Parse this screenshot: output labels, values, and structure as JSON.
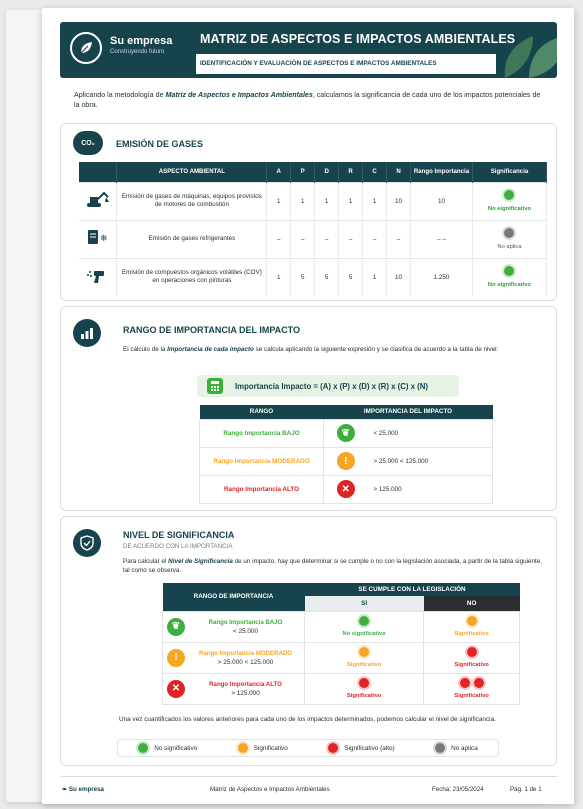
{
  "header": {
    "brand": "Su empresa",
    "tagline": "Construyendo futuro",
    "title": "MATRIZ DE ASPECTOS E IMPACTOS AMBIENTALES",
    "subtitle": "IDENTIFICACIÓN Y EVALUACIÓN DE ASPECTOS E IMPACTOS AMBIENTALES"
  },
  "intro": {
    "pre": "Aplicando la metodología de ",
    "bold": "Matriz de Aspectos e Impactos Ambientales",
    "post": ", calculamos la significancia de cada uno de los impactos potenciales de la obra."
  },
  "emision": {
    "icon_text": "CO₂",
    "title": "EMISIÓN DE GASES",
    "columns": [
      "ASPECTO AMBIENTAL",
      "A",
      "P",
      "D",
      "R",
      "C",
      "N",
      "Rango Importancia",
      "Significancia"
    ],
    "rows": [
      {
        "icon": "excavator-icon",
        "aspect": "Emisión de gases de máquinas, equipos provistos de motores de combustión",
        "A": "1",
        "P": "1",
        "D": "1",
        "R": "1",
        "C": "1",
        "N": "10",
        "rango": "10",
        "sig": "No significativo",
        "sig_color": "#3fae3f"
      },
      {
        "icon": "refrigerator-icon",
        "aspect": "Emisión de gases refrigerantes",
        "A": "–",
        "P": "–",
        "D": "–",
        "R": "–",
        "C": "–",
        "N": "–",
        "rango": "– –",
        "sig": "No aplica",
        "sig_color": "#7a7a7a"
      },
      {
        "icon": "spray-gun-icon",
        "aspect": "Emisión de compuestos orgánicos volátiles (COV) en operaciones con pinturas",
        "A": "1",
        "P": "5",
        "D": "5",
        "R": "5",
        "C": "1",
        "N": "10",
        "rango": "1.250",
        "sig": "No significativo",
        "sig_color": "#3fae3f"
      }
    ]
  },
  "rango": {
    "title": "RANGO DE IMPORTANCIA DEL IMPACTO",
    "p_pre": "El cálculo de la ",
    "p_bold": "Importancia de cada impacto",
    "p_post": " se calcula aplicando la siguiente expresión y se clasifica de acuerdo a la tabla de nivel:",
    "formula": "Importancia Impacto = (A) x (P) x (D) x (R) x (C) x (N)",
    "col_rango": "RANGO",
    "col_imp": "IMPORTANCIA DEL IMPACTO",
    "rows": [
      {
        "label": "Rango Importancia BAJO",
        "color": "#3fae3f",
        "symbol": "❦",
        "value": "< 25.000"
      },
      {
        "label": "Rango Importancia MODERADO",
        "color": "#f5a623",
        "symbol": "!",
        "value": "> 25.000  < 125.000"
      },
      {
        "label": "Rango Importancia ALTO",
        "color": "#e02424",
        "symbol": "✕",
        "value": "> 125.000"
      }
    ]
  },
  "nivel": {
    "title": "NIVEL DE SIGNIFICANCIA",
    "subtitle": "DE ACUERDO CON LA IMPORTANCIA",
    "p_pre": "Para calcular el ",
    "p_bold": "Nivel de Significancia",
    "p_post": " de un impacto, hay que determinar si se cumple o no con la legislación asociada, a partir de la tabla siguiente, tal como se observa.",
    "col_rango": "RANGO DE IMPORTANCIA",
    "col_legis": "SE CUMPLE CON LA LEGISLACIÓN",
    "col_si": "SI",
    "col_no": "NO",
    "rows": [
      {
        "label": "Rango Importancia BAJO",
        "value": "< 25.000",
        "color": "#3fae3f",
        "symbol": "❦",
        "si": "No significativo",
        "si_color": "#3fae3f",
        "no": "Significativo",
        "no_color": "#f5a623",
        "no_double": false
      },
      {
        "label": "Rango Importancia MODERADO",
        "value": "> 25.000  < 125.000",
        "color": "#f5a623",
        "symbol": "!",
        "si": "Significativo",
        "si_color": "#f5a623",
        "no": "Significativo",
        "no_color": "#e02424",
        "no_double": false
      },
      {
        "label": "Rango Importancia ALTO",
        "value": "> 125.000",
        "color": "#e02424",
        "symbol": "✕",
        "si": "Significativo",
        "si_color": "#e02424",
        "no": "Significativo",
        "no_color": "#e02424",
        "no_double": true
      }
    ],
    "closing": "Una vez cuantificados los valores anteriores para cada uno de los impactos determinados, podemos calcular el nivel de significancia.",
    "legend": [
      {
        "label": "No significativo",
        "color": "#3fae3f"
      },
      {
        "label": "Significativo",
        "color": "#f5a623"
      },
      {
        "label": "Significativo (alto)",
        "color": "#e02424"
      },
      {
        "label": "No aplica",
        "color": "#7a7a7a"
      }
    ]
  },
  "footer": {
    "brand": "Su empresa",
    "doc": "Matriz de Aspectos e Impactos Ambientales",
    "date": "Fecha: 23/05/2024",
    "page": "Pág. 1 de 1"
  }
}
